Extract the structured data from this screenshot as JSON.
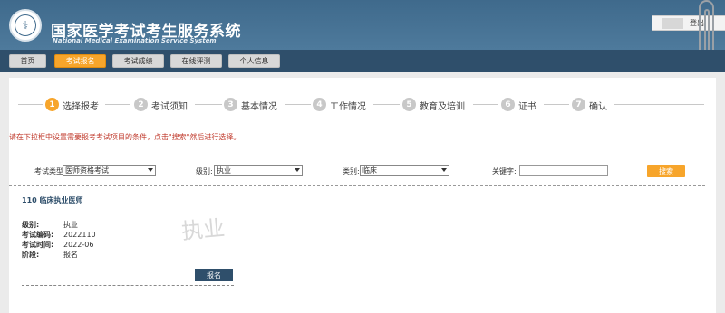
{
  "header": {
    "title_cn": "国家医学考试考生服务系统",
    "title_en": "National Medical Examination Service System",
    "logo_icon": "medical-emblem-icon",
    "logout_label": "登出"
  },
  "nav": {
    "items": [
      {
        "label": "首页",
        "active": false
      },
      {
        "label": "考试报名",
        "active": true
      },
      {
        "label": "考试成绩",
        "active": false
      },
      {
        "label": "在线评测",
        "active": false
      },
      {
        "label": "个人信息",
        "active": false
      }
    ]
  },
  "steps": [
    {
      "num": "1",
      "label": "选择报考",
      "active": true
    },
    {
      "num": "2",
      "label": "考试须知",
      "active": false
    },
    {
      "num": "3",
      "label": "基本情况",
      "active": false
    },
    {
      "num": "4",
      "label": "工作情况",
      "active": false
    },
    {
      "num": "5",
      "label": "教育及培训",
      "active": false
    },
    {
      "num": "6",
      "label": "证书",
      "active": false
    },
    {
      "num": "7",
      "label": "确认",
      "active": false
    }
  ],
  "notice": "请在下拉框中设置需要报考考试项目的条件，点击\"搜索\"然后进行选择。",
  "filters": {
    "exam_type_label": "考试类型:",
    "exam_type_value": "医师资格考试",
    "level_label": "级别:",
    "level_value": "执业",
    "category_label": "类别:",
    "category_value": "临床",
    "keyword_label": "关键字:",
    "keyword_value": "",
    "search_label": "搜索"
  },
  "result": {
    "title": "110 临床执业医师",
    "watermark": "执业",
    "rows": [
      {
        "key": "级别:",
        "value": "执业"
      },
      {
        "key": "考试编码:",
        "value": "2022110"
      },
      {
        "key": "考试时间:",
        "value": "2022-06"
      },
      {
        "key": "阶段:",
        "value": "报名"
      }
    ],
    "apply_label": "报名"
  },
  "colors": {
    "header_bg": "#3f6a8c",
    "nav_bg": "#2f4f6b",
    "accent": "#f7a52b",
    "notice": "#c0392b"
  }
}
